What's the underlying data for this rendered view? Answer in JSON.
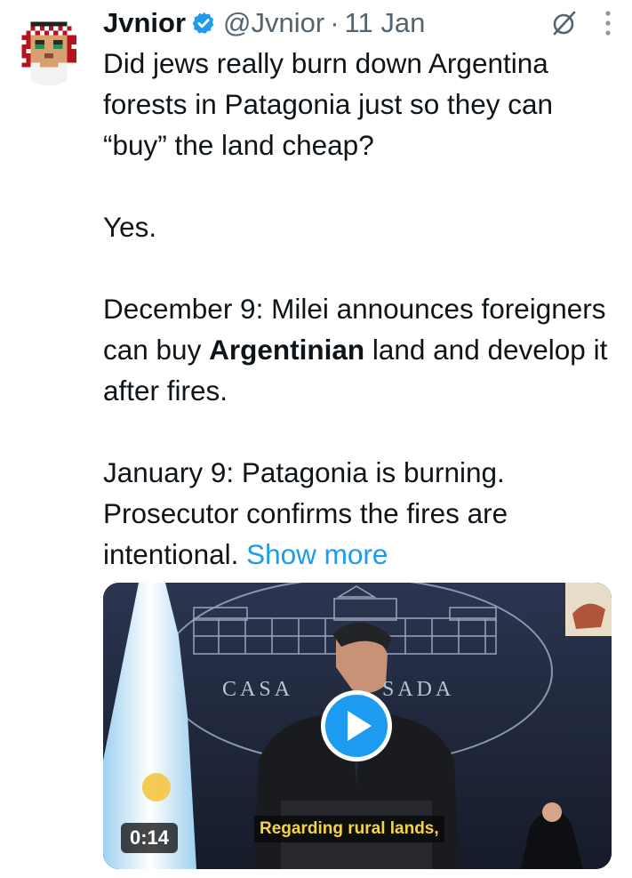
{
  "tweet": {
    "author_name": "Jvnior",
    "handle": "@Jvnior",
    "separator": "·",
    "date": "11 Jan",
    "text_p1": "Did jews really burn down Argentina forests in Patagonia just so they can “buy” the land cheap?",
    "text_p2": "Yes.",
    "text_p3_before": "December 9: Milei announces foreigners can buy ",
    "text_p3_bold": "Argentinian",
    "text_p3_after": " land and develop it after fires.",
    "text_p4": "January 9: Patagonia is burning. Prosecutor confirms the fires are intentional. ",
    "show_more": "Show more"
  },
  "media": {
    "duration": "0:14",
    "subtitle": "Regarding rural lands,",
    "building_text_left": "CASA",
    "building_text_right": "SADA"
  },
  "icons": {
    "verified": "verified-badge-icon",
    "grok": "grok-icon",
    "more": "more-vertical-icon",
    "play": "play-icon"
  },
  "colors": {
    "link": "#1d9bf0",
    "secondary_text": "#536471",
    "primary_text": "#0f1419",
    "verified": "#1d9bf0"
  }
}
